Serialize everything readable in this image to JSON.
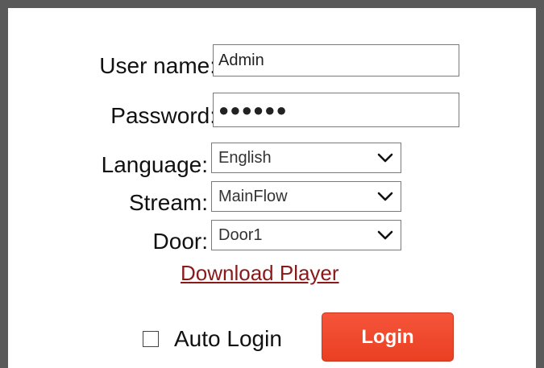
{
  "form": {
    "username_label": "User name:",
    "username_value": "Admin",
    "password_label": "Password:",
    "password_mask": "●●●●●●",
    "language_label": "Language:",
    "language_selected": "English",
    "stream_label": "Stream:",
    "stream_selected": "MainFlow",
    "door_label": "Door:",
    "door_selected": "Door1",
    "download_link": "Download Player",
    "auto_login_label": "Auto Login",
    "auto_login_checked": false,
    "login_button": "Login"
  },
  "colors": {
    "frame": "#5a5a5a",
    "link": "#8a1a1a",
    "login_button_bg": "#f04a2c",
    "field_border": "#7a7a7a"
  },
  "icons": {
    "select_arrow": "chevron-down-icon"
  }
}
